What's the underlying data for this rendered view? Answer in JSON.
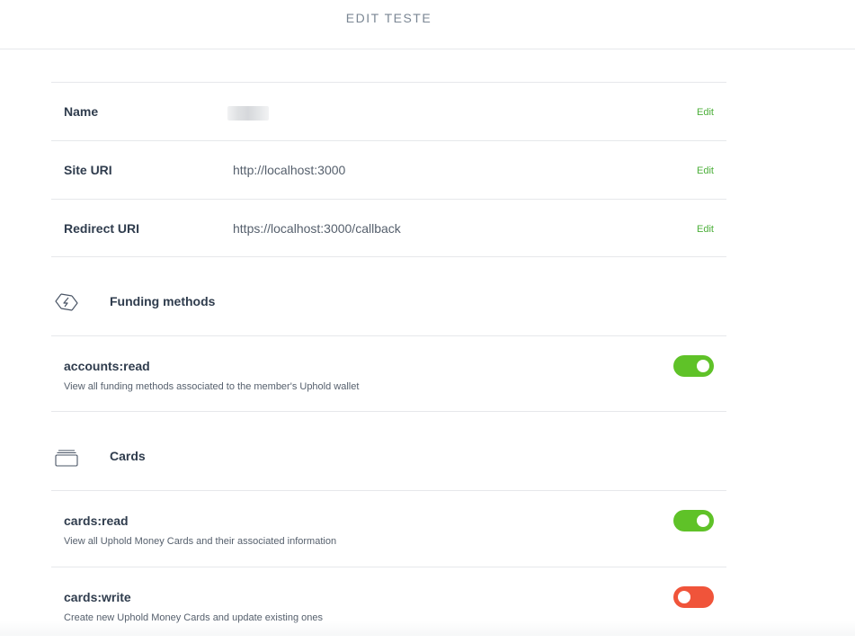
{
  "header": {
    "title": "EDIT TESTE"
  },
  "fields": [
    {
      "label": "Name",
      "value": "",
      "edit": "Edit"
    },
    {
      "label": "Site URI",
      "value": "http://localhost:3000",
      "edit": "Edit"
    },
    {
      "label": "Redirect URI",
      "value": "https://localhost:3000/callback",
      "edit": "Edit"
    }
  ],
  "sections": {
    "funding": {
      "title": "Funding methods",
      "icon": "funding-methods-icon",
      "permissions": [
        {
          "name": "accounts:read",
          "description": "View all funding methods associated to the member's Uphold wallet",
          "enabled": true
        }
      ]
    },
    "cards": {
      "title": "Cards",
      "icon": "cards-stack-icon",
      "permissions": [
        {
          "name": "cards:read",
          "description": "View all Uphold Money Cards and their associated information",
          "enabled": true
        },
        {
          "name": "cards:write",
          "description": "Create new Uphold Money Cards and update existing ones",
          "enabled": false
        }
      ]
    }
  },
  "colors": {
    "toggle_on": "#5fc228",
    "toggle_off": "#f0543a",
    "edit_link": "#4caf3a"
  }
}
